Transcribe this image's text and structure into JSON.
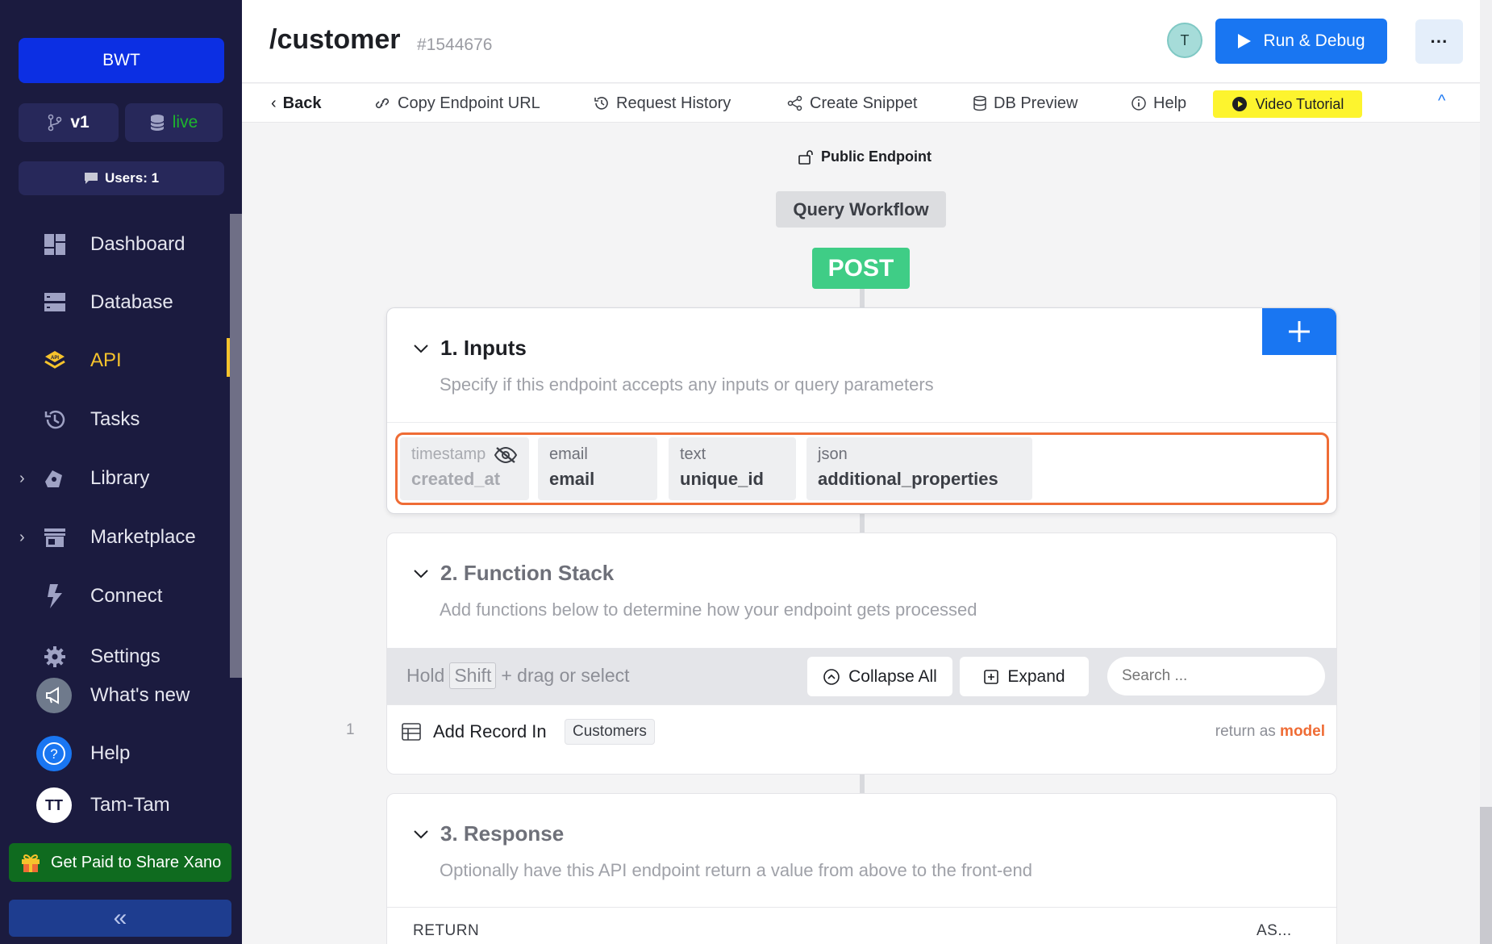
{
  "sidebar": {
    "workspace": "BWT",
    "branch": "v1",
    "environment": "live",
    "users": "Users: 1",
    "nav": [
      {
        "label": "Dashboard"
      },
      {
        "label": "Database"
      },
      {
        "label": "API"
      },
      {
        "label": "Tasks"
      },
      {
        "label": "Library"
      },
      {
        "label": "Marketplace"
      },
      {
        "label": "Connect"
      },
      {
        "label": "Settings"
      },
      {
        "label": "What's new"
      },
      {
        "label": "Help"
      },
      {
        "label": "Tam-Tam",
        "initials": "TT"
      }
    ],
    "promo": "Get Paid to Share Xano",
    "collapse": "«"
  },
  "header": {
    "title": "/customer",
    "id": "#1544676",
    "avatar": "T",
    "run": "Run & Debug",
    "more": "···"
  },
  "toolbar": {
    "back": "Back",
    "copy": "Copy Endpoint URL",
    "history": "Request History",
    "snippet": "Create Snippet",
    "db_preview": "DB Preview",
    "help": "Help",
    "video": "Video Tutorial"
  },
  "workflow": {
    "access": "Public Endpoint",
    "type": "Query Workflow",
    "method": "POST"
  },
  "inputs": {
    "title": "1. Inputs",
    "desc": "Specify if this endpoint accepts any inputs or query parameters",
    "items": [
      {
        "type": "timestamp",
        "name": "created_at"
      },
      {
        "type": "email",
        "name": "email"
      },
      {
        "type": "text",
        "name": "unique_id"
      },
      {
        "type": "json",
        "name": "additional_properties"
      }
    ]
  },
  "function_stack": {
    "title": "2. Function Stack",
    "desc": "Add functions below to determine how your endpoint gets processed",
    "hint_pre": "Hold",
    "hint_key": "Shift",
    "hint_post": "+ drag or select",
    "collapse_all": "Collapse All",
    "expand": "Expand",
    "search_placeholder": "Search ...",
    "rows": [
      {
        "num": "1",
        "name": "Add Record In",
        "table": "Customers",
        "return_label": "return as",
        "return_value": "model"
      }
    ]
  },
  "response": {
    "title": "3. Response",
    "desc": "Optionally have this API endpoint return a value from above to the front-end",
    "col_return": "RETURN",
    "col_as": "AS..."
  },
  "colors": {
    "sidebar_bg": "#1b1b3f",
    "accent": "#1976f2",
    "active_nav": "#f6c32c",
    "post": "#3fcd86",
    "highlight": "#ef6c35"
  }
}
